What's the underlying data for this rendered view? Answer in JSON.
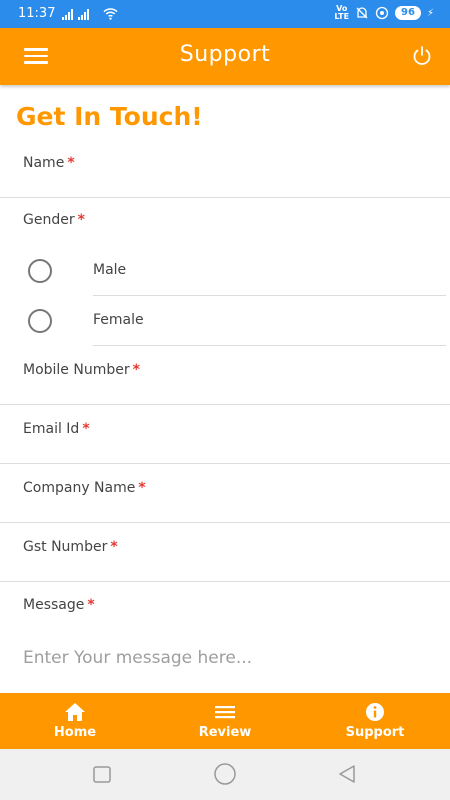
{
  "status_bar": {
    "time": "11:37",
    "volte": "Vo\nLTE",
    "battery": "96"
  },
  "app_bar": {
    "title": "Support",
    "menu_icon": "hamburger-menu-icon",
    "power_icon": "power-icon"
  },
  "form": {
    "heading": "Get In Touch!",
    "fields": {
      "name": "Name",
      "gender": "Gender",
      "mobile": "Mobile Number",
      "email": "Email Id",
      "company": "Company Name",
      "gst": "Gst Number",
      "message": "Message"
    },
    "required_marker": "*",
    "gender_options": [
      "Male",
      "Female"
    ],
    "message_placeholder": "Enter Your message here..."
  },
  "bottom_nav": {
    "items": [
      {
        "label": "Home",
        "icon": "home-icon"
      },
      {
        "label": "Review",
        "icon": "list-icon"
      },
      {
        "label": "Support",
        "icon": "info-icon"
      }
    ]
  },
  "colors": {
    "accent": "#ff9800",
    "status_bar": "#2b8ceb",
    "required": "#e53935"
  }
}
